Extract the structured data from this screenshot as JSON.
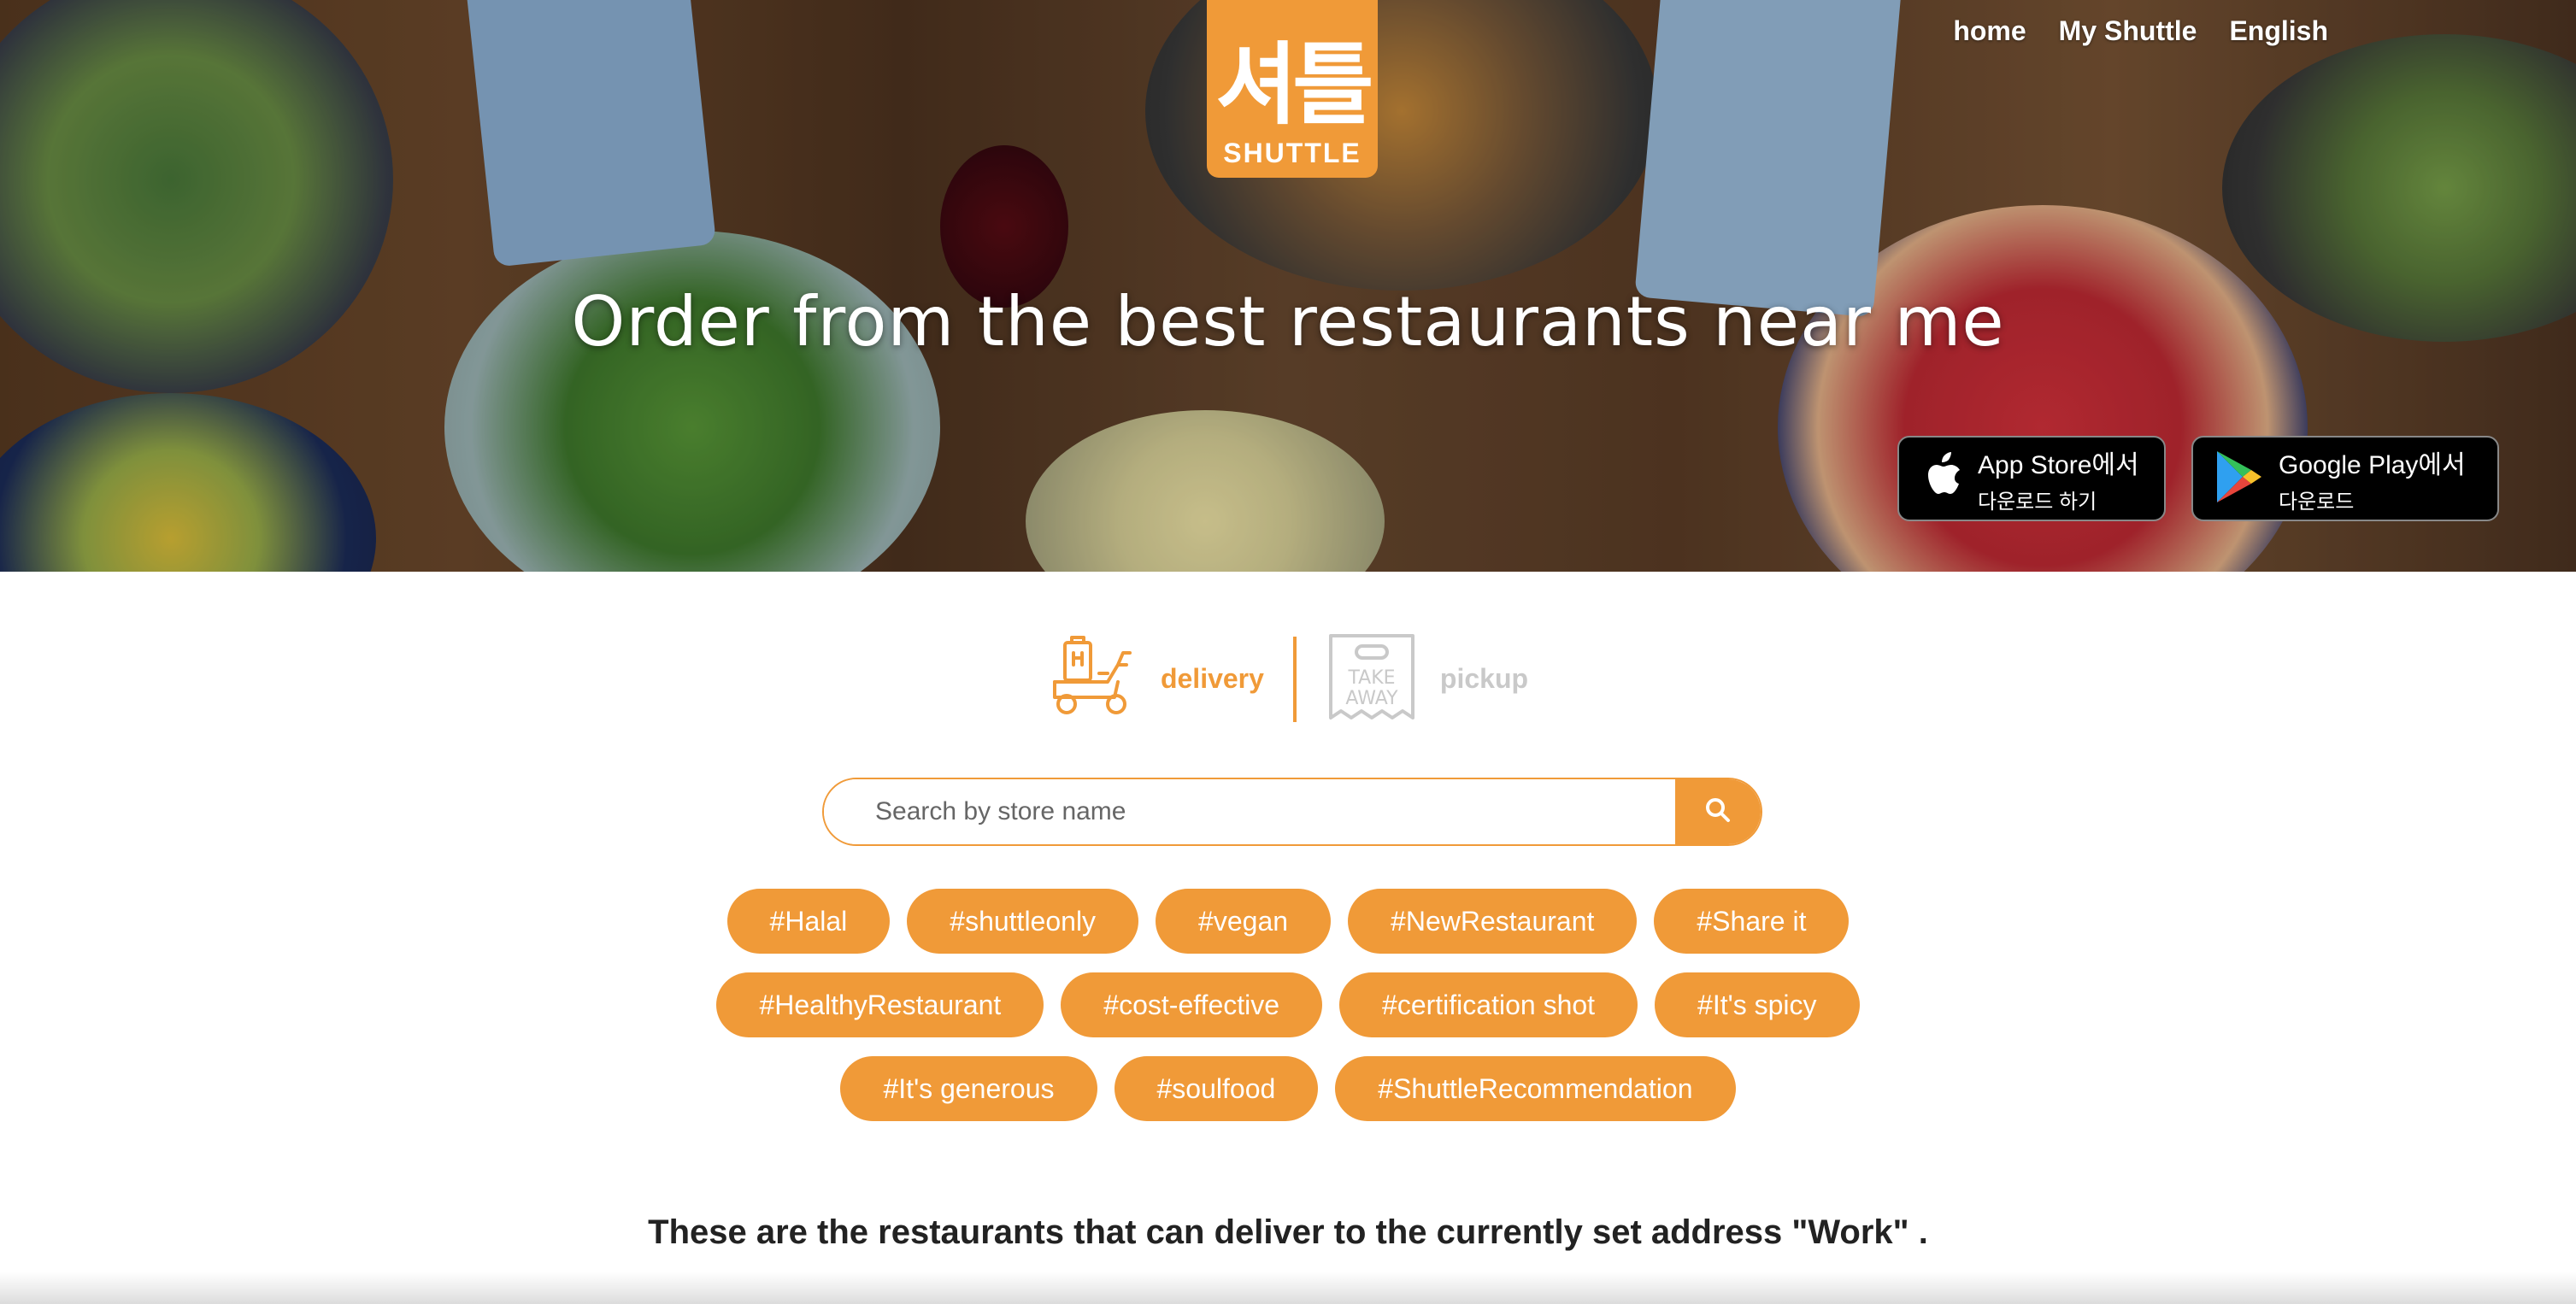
{
  "brand": {
    "logo_mark": "셔틀",
    "logo_word": "SHUTTLE"
  },
  "nav": {
    "items": [
      "home",
      "My Shuttle",
      "English"
    ]
  },
  "hero": {
    "title": "Order from the best restaurants near me"
  },
  "stores": {
    "apple": {
      "line1": "App Store에서",
      "line2": "다운로드 하기"
    },
    "google": {
      "line1": "Google Play에서",
      "line2": "다운로드"
    }
  },
  "modes": {
    "delivery": "delivery",
    "pickup": "pickup",
    "takeaway_line1": "TAKE",
    "takeaway_line2": "AWAY"
  },
  "search": {
    "placeholder": "Search by store name"
  },
  "tags": {
    "row1": [
      "#Halal",
      "#shuttleonly",
      "#vegan",
      "#NewRestaurant",
      "#Share it"
    ],
    "row2": [
      "#HealthyRestaurant",
      "#cost-effective",
      "#certification shot",
      "#It's spicy"
    ],
    "row3": [
      "#It's generous",
      "#soulfood",
      "#ShuttleRecommendation"
    ]
  },
  "notice": "These are the restaurants that can deliver to the currently set address \"Work\" .",
  "colors": {
    "accent": "#f09a38",
    "inactive": "#c9c9c9"
  }
}
